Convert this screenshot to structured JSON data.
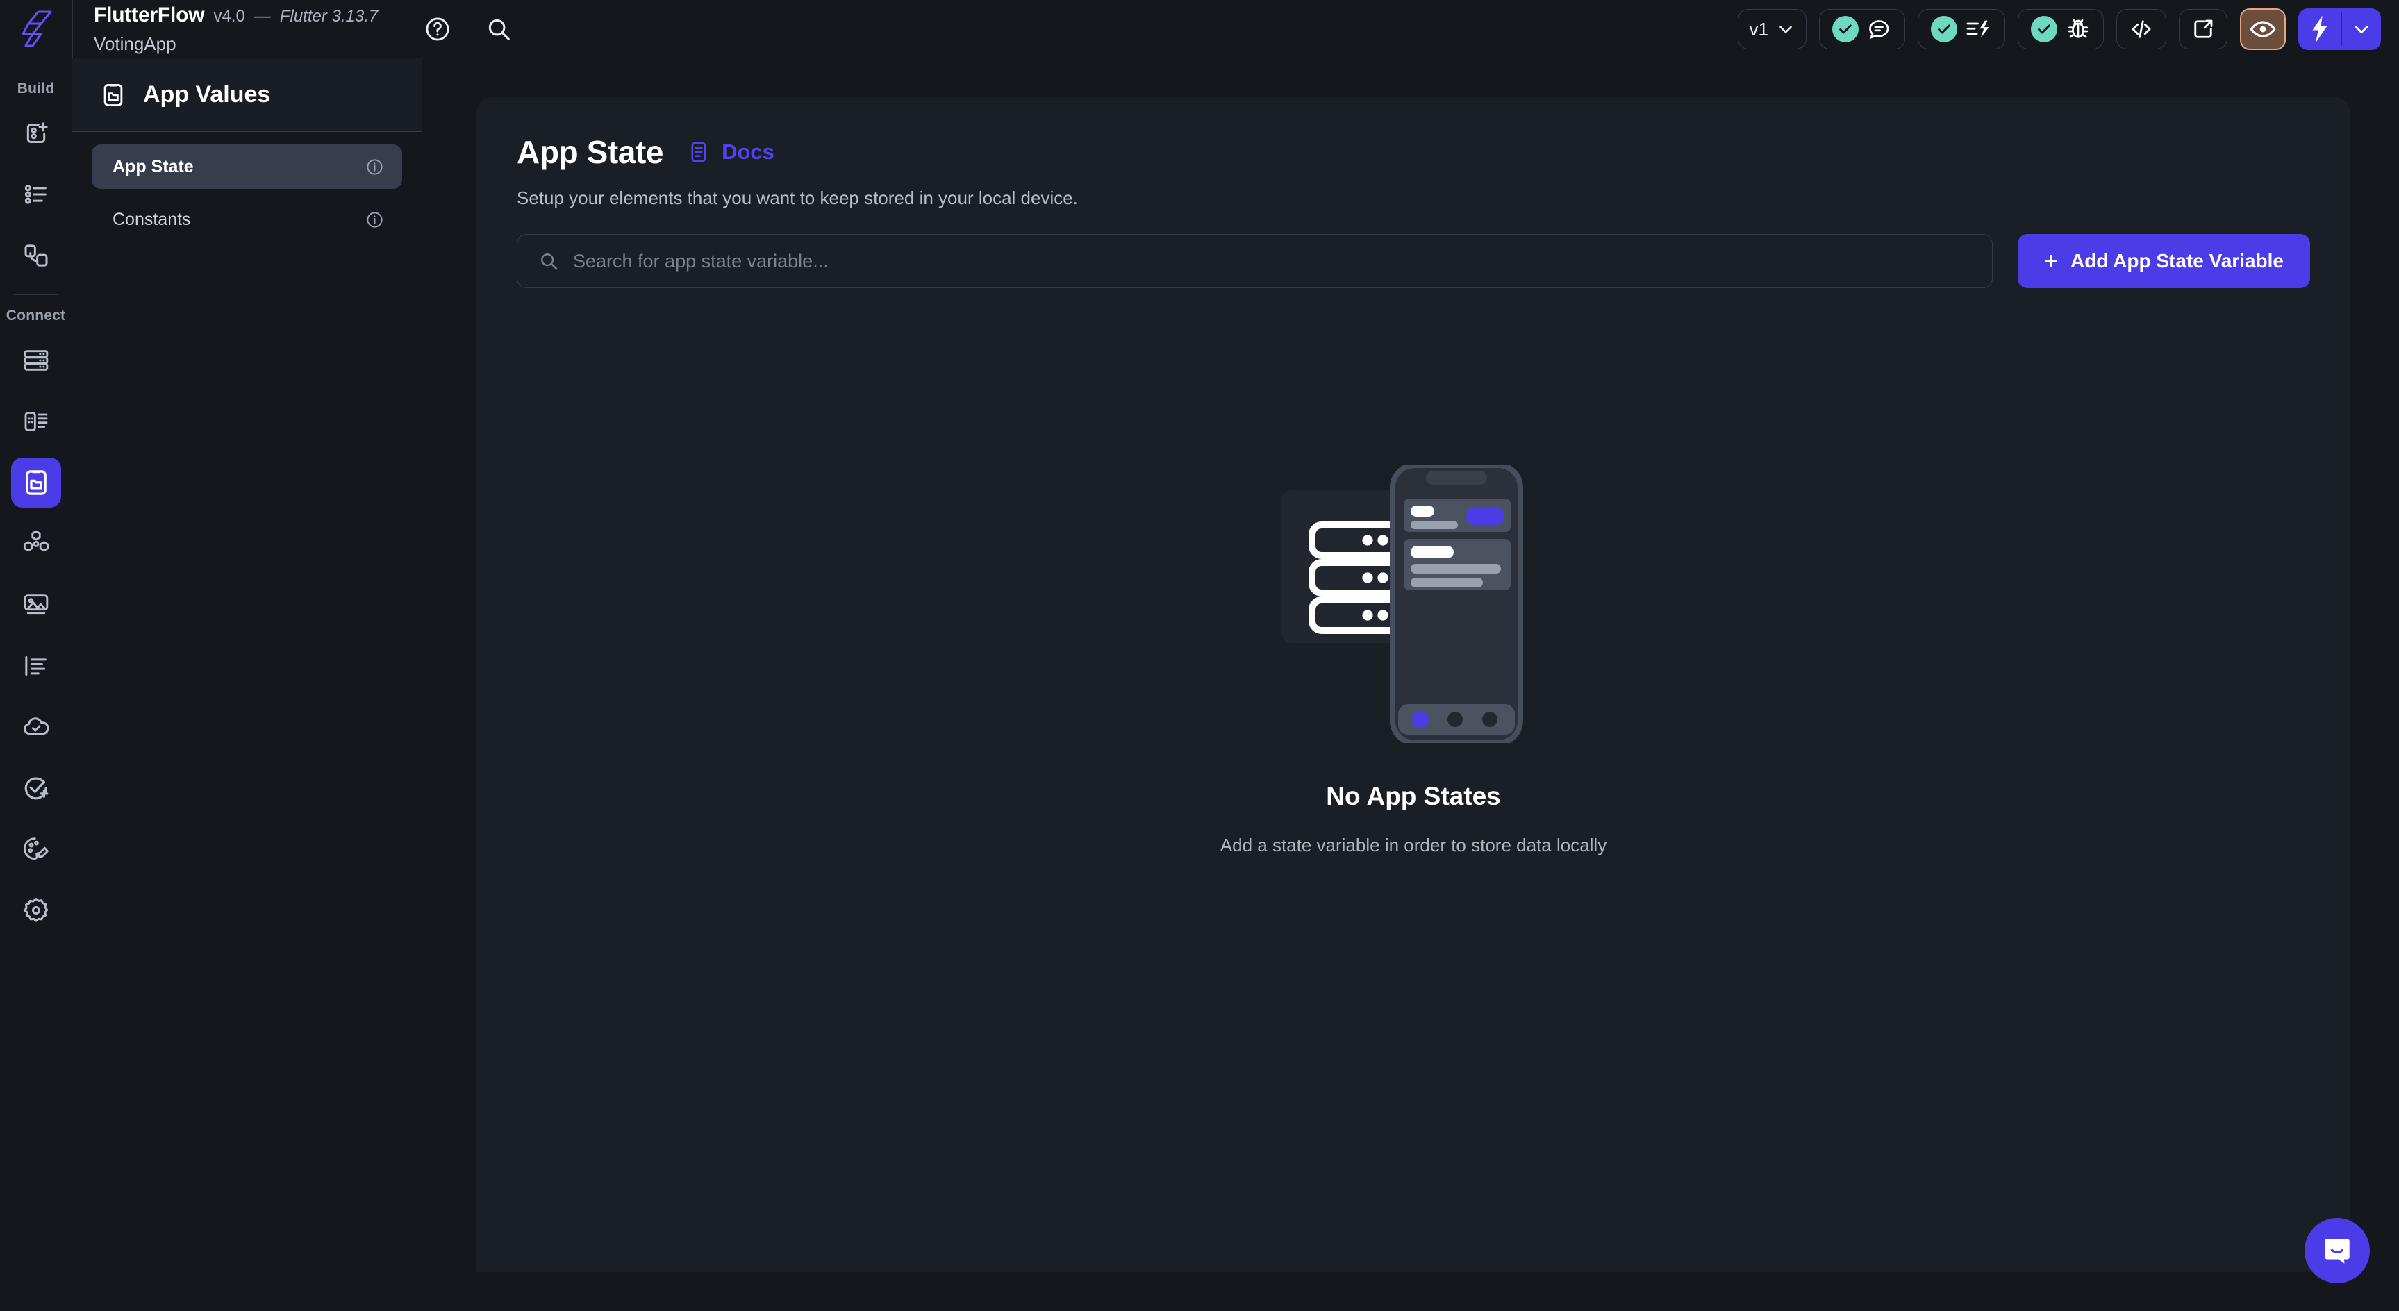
{
  "brand": {
    "name": "FlutterFlow",
    "version": "v4.0",
    "dash": "—",
    "flutter_version": "Flutter 3.13.7",
    "project": "VotingApp",
    "logo_icon": "flutterflow-logo-icon"
  },
  "topbar": {
    "help_icon": "help-circle-icon",
    "search_icon": "search-icon",
    "version_selector": {
      "label": "v1",
      "icon": "chevron-down-icon"
    },
    "buttons": [
      {
        "name": "comments-status-button",
        "icon": "comment-icon",
        "status": "check"
      },
      {
        "name": "actions-status-button",
        "icon": "lightning-lines-icon",
        "status": "check"
      },
      {
        "name": "debug-status-button",
        "icon": "bug-icon",
        "status": "check"
      },
      {
        "name": "code-view-button",
        "icon": "code-brackets-icon"
      },
      {
        "name": "open-external-button",
        "icon": "external-link-icon"
      },
      {
        "name": "preview-button",
        "icon": "eye-icon"
      }
    ],
    "run_button": {
      "icon": "lightning-bolt-icon",
      "dropdown_icon": "chevron-down-icon"
    }
  },
  "rail": {
    "sections": [
      {
        "label": "Build",
        "items": [
          {
            "name": "sidebar-item-add-page",
            "icon": "add-page-icon"
          },
          {
            "name": "sidebar-item-widget-palette",
            "icon": "bullet-list-icon"
          },
          {
            "name": "sidebar-item-page-flow",
            "icon": "page-flow-icon"
          }
        ]
      },
      {
        "label": "Connect",
        "items": [
          {
            "name": "sidebar-item-database",
            "icon": "database-icon",
            "active": false
          },
          {
            "name": "sidebar-item-api-calls",
            "icon": "api-list-icon",
            "active": false
          },
          {
            "name": "sidebar-item-app-values",
            "icon": "phone-folder-icon",
            "active": true
          },
          {
            "name": "sidebar-item-integrations",
            "icon": "hexagon-cluster-icon",
            "active": false
          },
          {
            "name": "sidebar-item-media-assets",
            "icon": "image-icon",
            "active": false
          },
          {
            "name": "sidebar-item-localization",
            "icon": "text-align-icon",
            "active": false
          },
          {
            "name": "sidebar-item-deployment",
            "icon": "cloud-check-icon",
            "active": false
          },
          {
            "name": "sidebar-item-tests",
            "icon": "check-plus-icon",
            "active": false
          },
          {
            "name": "sidebar-item-theme",
            "icon": "palette-brush-icon",
            "active": false
          },
          {
            "name": "sidebar-item-settings",
            "icon": "gear-icon",
            "active": false
          }
        ]
      }
    ]
  },
  "panel": {
    "title": "App Values",
    "title_icon": "phone-folder-icon",
    "items": [
      {
        "label": "App State",
        "selected": true,
        "info_icon": "info-icon"
      },
      {
        "label": "Constants",
        "selected": false,
        "info_icon": "info-icon"
      }
    ]
  },
  "main": {
    "title": "App State",
    "docs": {
      "label": "Docs",
      "icon": "docs-icon"
    },
    "subtitle": "Setup your elements that you want to keep stored in your local device.",
    "search": {
      "placeholder": "Search for app state variable...",
      "value": "",
      "icon": "search-icon"
    },
    "add_button": {
      "plus": "+",
      "label": "Add App State Variable"
    },
    "empty_state": {
      "illustration": "database-phone-illustration",
      "title": "No App States",
      "subtitle": "Add a state variable in order to store data locally"
    }
  },
  "chat": {
    "name": "intercom-chat-button",
    "icon": "chat-bubble-smile-icon"
  },
  "colors": {
    "accent_purple": "#4b3ce8",
    "docs_purple": "#5242f0",
    "status_green": "#6fd9c0",
    "preview_brown": "#6b4e3c",
    "preview_border": "#e9a57e",
    "page_bg": "#14171c",
    "card_bg": "#1a1e25"
  }
}
